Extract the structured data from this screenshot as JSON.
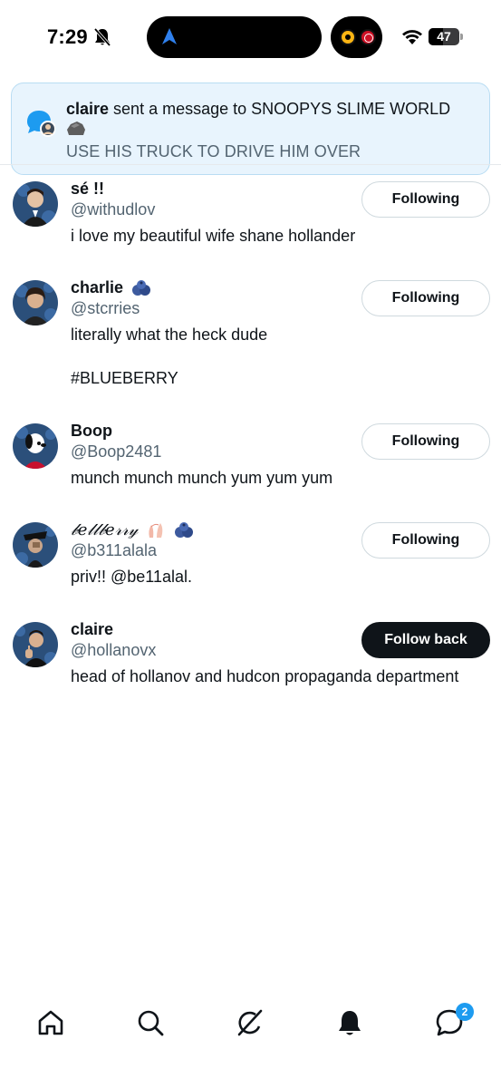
{
  "status_bar": {
    "time": "7:29",
    "battery": "47",
    "battery_level_percent": 47
  },
  "notification": {
    "sender": "claire",
    "action_text": " sent a message to SNOOPYS SLIME WORLD",
    "message": "USE HIS TRUCK TO DRIVE HIM OVER"
  },
  "users": [
    {
      "name": "sé !!",
      "handle": "@withudlov",
      "bio": "i love my beautiful wife shane hollander",
      "button": "Following"
    },
    {
      "name": "charlie",
      "handle": "@stcrries",
      "bio": "literally what the heck dude\n\n#BLUEBERRY",
      "button": "Following",
      "badge": "blueberry-emoji"
    },
    {
      "name": "Boop",
      "handle": "@Boop2481",
      "bio": "munch munch munch yum yum yum",
      "button": "Following"
    },
    {
      "name": "𝒷𝑒𝓁𝓁𝒷𝑒𝓇𝓇𝓎",
      "handle": "@b311alala",
      "bio": "priv!! @be11alal.",
      "button": "Following",
      "badge": "ballet-shoes-emoji, blueberry-emoji"
    },
    {
      "name": "claire",
      "handle": "@hollanovx",
      "bio": "head of hollanov and hudcon propaganda department",
      "button": "Follow back"
    }
  ],
  "bottom_nav": {
    "items": [
      "home-icon",
      "search-icon",
      "grok-icon",
      "notifications-icon",
      "messages-icon"
    ],
    "messages_badge": "2"
  },
  "colors": {
    "accent": "#1d9bf0",
    "text": "#0f1419",
    "secondary": "#536471",
    "banner_bg": "#e8f4fd"
  }
}
